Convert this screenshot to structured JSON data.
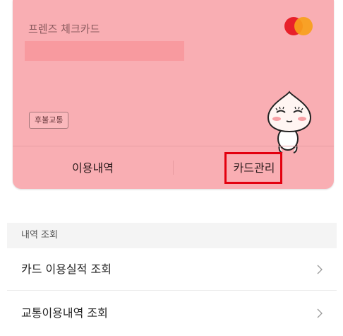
{
  "card": {
    "name": "프렌즈 체크카드",
    "badge": "후불교통",
    "tabs": {
      "usage": "이용내역",
      "manage": "카드관리"
    }
  },
  "icons": {
    "brand": "mastercard-logo",
    "character": "apeach-character"
  },
  "section": {
    "header": "내역 조회",
    "items": [
      {
        "label": "카드 이용실적 조회"
      },
      {
        "label": "교통이용내역 조회"
      }
    ]
  },
  "colors": {
    "card_bg": "#f9aeb3",
    "highlight": "#e3000f"
  }
}
